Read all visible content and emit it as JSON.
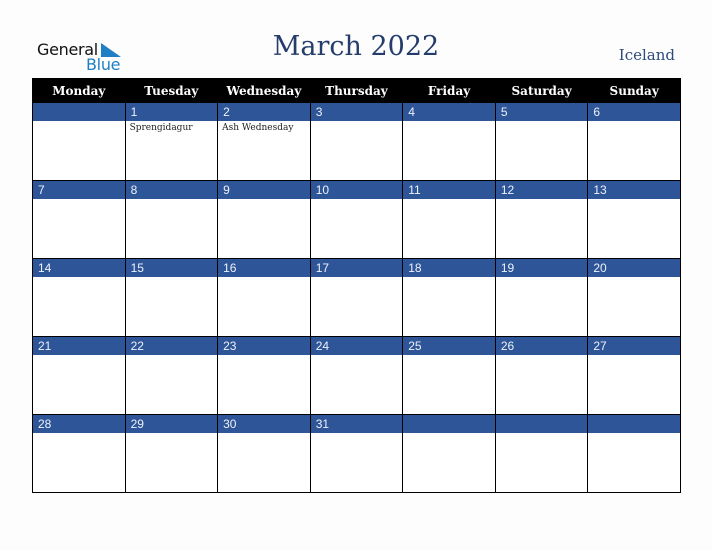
{
  "logo": {
    "line1": "General",
    "line2": "Blue"
  },
  "title": "March 2022",
  "country": "Iceland",
  "colors": {
    "band": "#2d5597",
    "header": "#000000",
    "title": "#253d6b"
  },
  "weekdays": [
    "Monday",
    "Tuesday",
    "Wednesday",
    "Thursday",
    "Friday",
    "Saturday",
    "Sunday"
  ],
  "weeks": [
    [
      {
        "day": "",
        "event": ""
      },
      {
        "day": "1",
        "event": "Sprengidagur"
      },
      {
        "day": "2",
        "event": "Ash Wednesday"
      },
      {
        "day": "3",
        "event": ""
      },
      {
        "day": "4",
        "event": ""
      },
      {
        "day": "5",
        "event": ""
      },
      {
        "day": "6",
        "event": ""
      }
    ],
    [
      {
        "day": "7",
        "event": ""
      },
      {
        "day": "8",
        "event": ""
      },
      {
        "day": "9",
        "event": ""
      },
      {
        "day": "10",
        "event": ""
      },
      {
        "day": "11",
        "event": ""
      },
      {
        "day": "12",
        "event": ""
      },
      {
        "day": "13",
        "event": ""
      }
    ],
    [
      {
        "day": "14",
        "event": ""
      },
      {
        "day": "15",
        "event": ""
      },
      {
        "day": "16",
        "event": ""
      },
      {
        "day": "17",
        "event": ""
      },
      {
        "day": "18",
        "event": ""
      },
      {
        "day": "19",
        "event": ""
      },
      {
        "day": "20",
        "event": ""
      }
    ],
    [
      {
        "day": "21",
        "event": ""
      },
      {
        "day": "22",
        "event": ""
      },
      {
        "day": "23",
        "event": ""
      },
      {
        "day": "24",
        "event": ""
      },
      {
        "day": "25",
        "event": ""
      },
      {
        "day": "26",
        "event": ""
      },
      {
        "day": "27",
        "event": ""
      }
    ],
    [
      {
        "day": "28",
        "event": ""
      },
      {
        "day": "29",
        "event": ""
      },
      {
        "day": "30",
        "event": ""
      },
      {
        "day": "31",
        "event": ""
      },
      {
        "day": "",
        "event": ""
      },
      {
        "day": "",
        "event": ""
      },
      {
        "day": "",
        "event": ""
      }
    ]
  ]
}
